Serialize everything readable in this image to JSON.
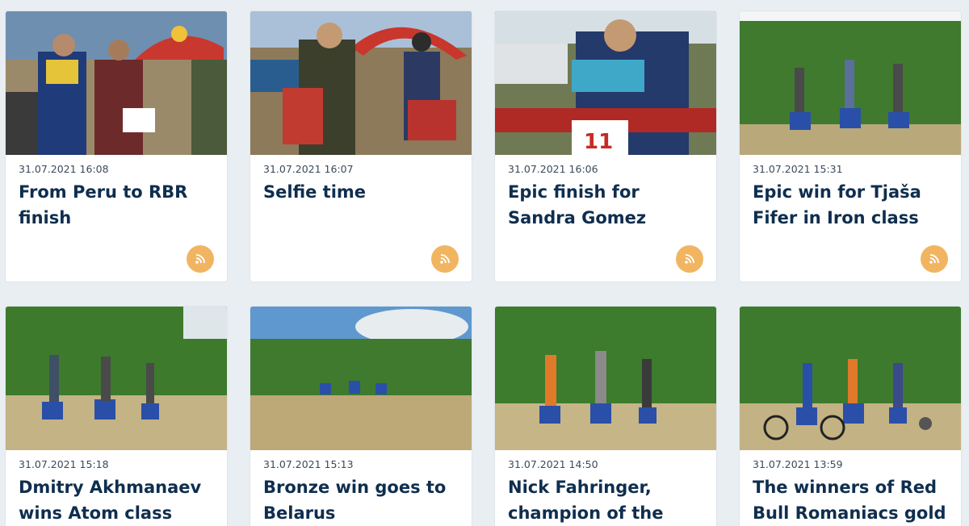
{
  "cards": [
    {
      "time": "31.07.2021 16:08",
      "title": "From Peru to RBR finish"
    },
    {
      "time": "31.07.2021 16:07",
      "title": "Selfie time"
    },
    {
      "time": "31.07.2021 16:06",
      "title": "Epic finish for Sandra Gomez"
    },
    {
      "time": "31.07.2021 15:31",
      "title": "Epic win for Tjaša Fifer in Iron class"
    },
    {
      "time": "31.07.2021 15:18",
      "title": "Dmitry Akhmanaev wins Atom class"
    },
    {
      "time": "31.07.2021 15:13",
      "title": "Bronze win goes to Belarus"
    },
    {
      "time": "31.07.2021 14:50",
      "title": "Nick Fahringer, champion of the"
    },
    {
      "time": "31.07.2021 13:59",
      "title": "The winners of Red Bull Romaniacs gold"
    }
  ],
  "icons": {
    "feed": "rss-icon"
  },
  "colors": {
    "title": "#0f2e4f",
    "rss_badge": "#f1b562",
    "background": "#e9eef3"
  }
}
